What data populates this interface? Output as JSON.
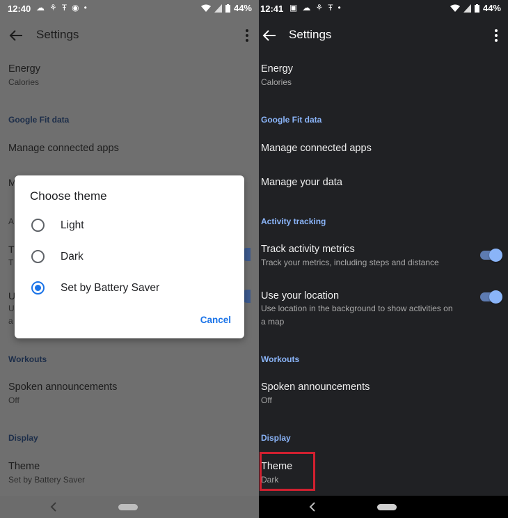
{
  "left": {
    "status": {
      "time": "12:40",
      "battery": "44%"
    },
    "appbar": {
      "title": "Settings"
    },
    "energy": {
      "title": "Energy",
      "subtitle": "Calories"
    },
    "sections": {
      "google_fit": "Google Fit data",
      "workouts": "Workouts",
      "display": "Display"
    },
    "items": {
      "manage_apps": "Manage connected apps",
      "spoken": {
        "title": "Spoken announcements",
        "subtitle": "Off"
      },
      "theme": {
        "title": "Theme",
        "subtitle": "Set by Battery Saver"
      }
    },
    "partials": {
      "m": "M",
      "a": "A",
      "t": "T",
      "t2": "T",
      "u": "U",
      "u2": "U",
      "a2": "a"
    },
    "dialog": {
      "title": "Choose theme",
      "options": [
        "Light",
        "Dark",
        "Set by Battery Saver"
      ],
      "selected": "Set by Battery Saver",
      "cancel": "Cancel"
    }
  },
  "right": {
    "status": {
      "time": "12:41",
      "battery": "44%"
    },
    "appbar": {
      "title": "Settings"
    },
    "energy": {
      "title": "Energy",
      "subtitle": "Calories"
    },
    "sections": {
      "google_fit": "Google Fit data",
      "activity": "Activity tracking",
      "workouts": "Workouts",
      "display": "Display"
    },
    "items": {
      "manage_apps": "Manage connected apps",
      "manage_data": "Manage your data",
      "track": {
        "title": "Track activity metrics",
        "subtitle": "Track your metrics, including steps and distance",
        "enabled": true
      },
      "location": {
        "title": "Use your location",
        "subtitle_line1": "Use location in the background to show activities on",
        "subtitle_line2": "a map",
        "enabled": true
      },
      "spoken": {
        "title": "Spoken announcements",
        "subtitle": "Off"
      },
      "theme": {
        "title": "Theme",
        "subtitle": "Dark"
      }
    }
  },
  "colors": {
    "accent": "#8ab4f8",
    "dialog_accent": "#1a73e8",
    "dark_bg": "#202124",
    "highlight": "#d1202f"
  }
}
